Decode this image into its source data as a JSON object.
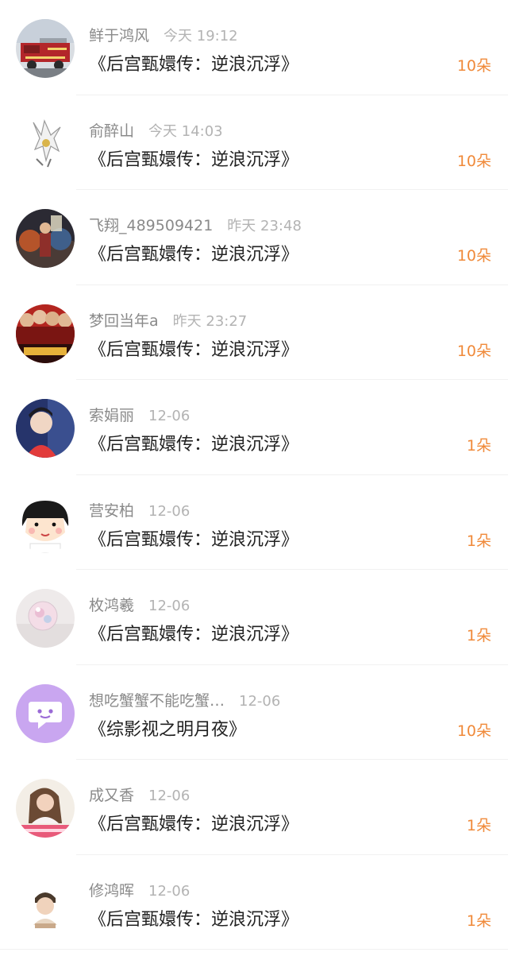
{
  "gift_list": [
    {
      "name": "鲜于鸿风",
      "time": "今天 19:12",
      "book": "《后宫甄嬛传：逆浪沉浮》",
      "amount": "10朵",
      "avatar_icon": "fire-truck-avatar"
    },
    {
      "name": "俞醉山",
      "time": "今天 14:03",
      "book": "《后宫甄嬛传：逆浪沉浮》",
      "amount": "10朵",
      "avatar_icon": "white-creature-avatar"
    },
    {
      "name": "飞翔_489509421",
      "time": "昨天 23:48",
      "book": "《后宫甄嬛传：逆浪沉浮》",
      "amount": "10朵",
      "avatar_icon": "movie-poster-avatar"
    },
    {
      "name": "梦回当年a",
      "time": "昨天 23:27",
      "book": "《后宫甄嬛传：逆浪沉浮》",
      "amount": "10朵",
      "avatar_icon": "red-poster-avatar"
    },
    {
      "name": "索娟丽",
      "time": "12-06",
      "book": "《后宫甄嬛传：逆浪沉浮》",
      "amount": "1朵",
      "avatar_icon": "portrait-avatar"
    },
    {
      "name": "营安柏",
      "time": "12-06",
      "book": "《后宫甄嬛传：逆浪沉浮》",
      "amount": "1朵",
      "avatar_icon": "cartoon-girl-avatar"
    },
    {
      "name": "枚鸿羲",
      "time": "12-06",
      "book": "《后宫甄嬛传：逆浪沉浮》",
      "amount": "1朵",
      "avatar_icon": "crystal-ball-avatar"
    },
    {
      "name": "想吃蟹蟹不能吃蟹…",
      "time": "12-06",
      "book": "《综影视之明月夜》",
      "amount": "10朵",
      "avatar_icon": "chat-bubble-avatar"
    },
    {
      "name": "成又香",
      "time": "12-06",
      "book": "《后宫甄嬛传：逆浪沉浮》",
      "amount": "1朵",
      "avatar_icon": "girl-photo-avatar"
    },
    {
      "name": "修鸿晖",
      "time": "12-06",
      "book": "《后宫甄嬛传：逆浪沉浮》",
      "amount": "1朵",
      "avatar_icon": "boy-photo-avatar"
    }
  ],
  "colors": {
    "name": "#8a8a8a",
    "time": "#b3b3b3",
    "title": "#222222",
    "amount": "#f08a3a",
    "divider": "#f1f1f1"
  }
}
